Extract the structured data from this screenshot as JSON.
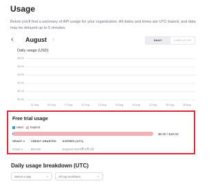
{
  "page": {
    "title": "Usage",
    "description": "Below you'll find a summary of API usage for your organization. All dates and times are UTC-based, and data may be delayed up to 5 minutes."
  },
  "month_nav": {
    "prev_icon": "‹",
    "next_icon": "›",
    "month": "August"
  },
  "toggle": {
    "daily": "DAILY",
    "cumulative": "CUMULATIVE"
  },
  "chart": {
    "title": "Daily usage (USD)"
  },
  "chart_data": {
    "type": "bar",
    "title": "Daily usage (USD)",
    "categories": [
      "31 Aug",
      "04 Aug",
      "07 Aug",
      "10 Aug",
      "13 Aug",
      "16 Aug",
      "19 Aug",
      "22 Aug",
      "25 Aug",
      "28 Aug"
    ],
    "values": [
      0,
      0,
      0,
      0,
      0,
      0,
      0,
      0,
      0,
      0
    ],
    "y_ticks": [
      "$5.00",
      "$4.00",
      "$3.00",
      "$2.00",
      "$1.00",
      "$0.00"
    ],
    "ylim": [
      0,
      5
    ],
    "grid": true
  },
  "trial": {
    "title": "Free trial usage",
    "legend_used": "Used",
    "legend_expired": "Expired",
    "amount": "$0.00 / $18.00",
    "used_fraction": 0.005,
    "colors": {
      "used": "#3f8fd1",
      "expired": "#f2b0b7"
    },
    "columns": [
      "GRANT #",
      "CREDIT GRANTED",
      "EXPIRES (UTC)"
    ],
    "rows": [
      {
        "grant": "Grant 1",
        "credit": "$18.00",
        "expires": "Expired 2023年4月1日"
      }
    ]
  },
  "breakdown": {
    "title": "Daily usage breakdown (UTC)",
    "day_select": "Select a day",
    "member_select": "All org members"
  }
}
